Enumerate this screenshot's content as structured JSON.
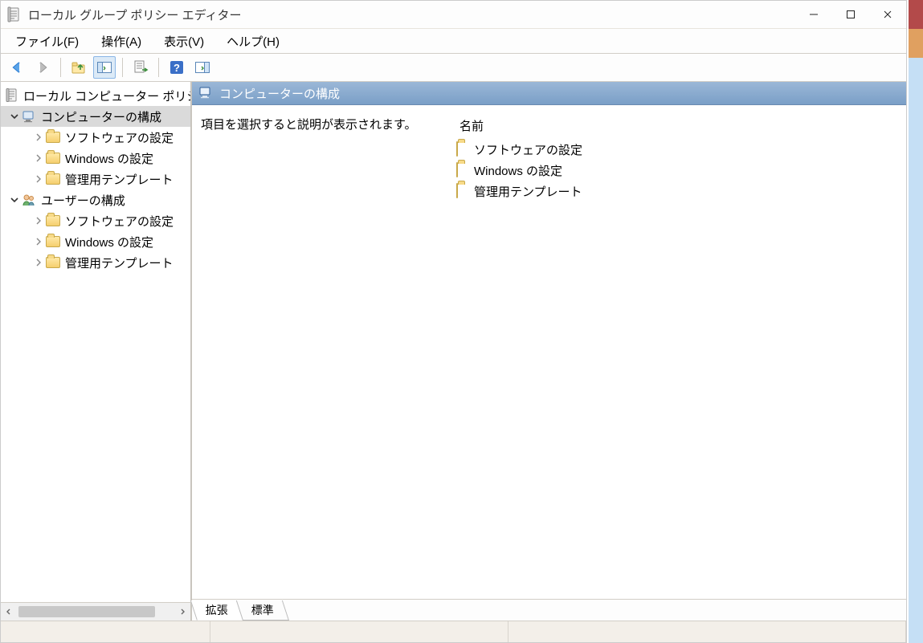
{
  "window": {
    "title": "ローカル グループ ポリシー エディター"
  },
  "menu": {
    "file": "ファイル(F)",
    "action": "操作(A)",
    "view": "表示(V)",
    "help": "ヘルプ(H)"
  },
  "toolbar": {
    "back_icon": "back-arrow",
    "forward_icon": "forward-arrow",
    "up_icon": "folder-up",
    "show_hide_tree_icon": "tree-panel",
    "export_icon": "export-list",
    "help_icon": "help",
    "show_hide_actions_icon": "actions-panel"
  },
  "tree": {
    "root": {
      "label": "ローカル コンピューター ポリシ"
    },
    "comp": {
      "label": "コンピューターの構成"
    },
    "comp_sw": {
      "label": "ソフトウェアの設定"
    },
    "comp_win": {
      "label": "Windows の設定"
    },
    "comp_adm": {
      "label": "管理用テンプレート"
    },
    "user": {
      "label": "ユーザーの構成"
    },
    "user_sw": {
      "label": "ソフトウェアの設定"
    },
    "user_win": {
      "label": "Windows の設定"
    },
    "user_adm": {
      "label": "管理用テンプレート"
    }
  },
  "content": {
    "header": "コンピューターの構成",
    "description": "項目を選択すると説明が表示されます。",
    "column_name": "名前",
    "items": {
      "0": "ソフトウェアの設定",
      "1": "Windows の設定",
      "2": "管理用テンプレート"
    }
  },
  "tabs": {
    "extended": "拡張",
    "standard": "標準"
  }
}
